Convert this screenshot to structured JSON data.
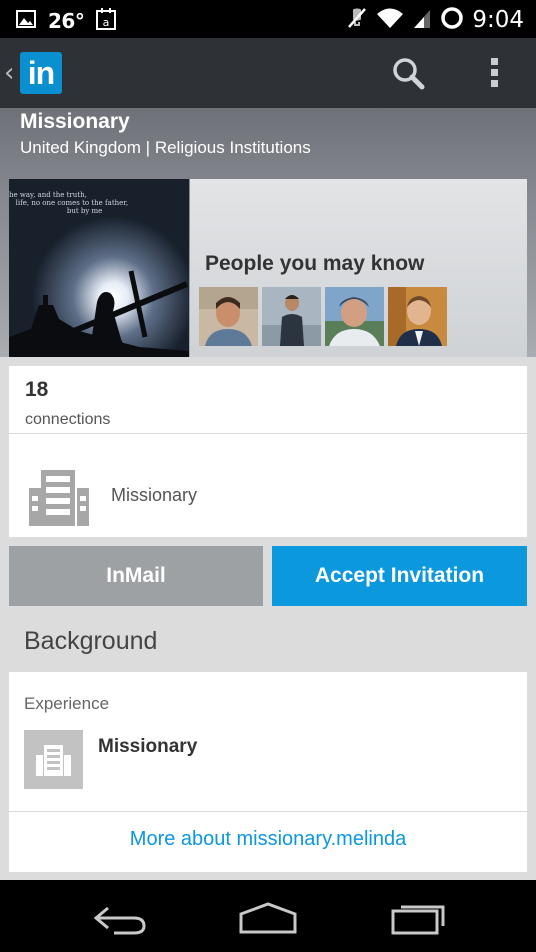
{
  "status_bar": {
    "temperature": "26°",
    "time": "9:04",
    "icons": [
      "picture-icon",
      "calendar-icon",
      "mute-icon",
      "wifi-icon",
      "signal-icon",
      "sync-circle-icon"
    ]
  },
  "action_bar": {
    "logo_text": "in",
    "icons": [
      "back-chevron-icon",
      "search-icon",
      "overflow-menu-icon"
    ]
  },
  "profile": {
    "name": "Missionary",
    "subtitle": "United Kingdom | Religious Institutions",
    "background_photo_quote": "he way, and the truth,\n   life, no one comes to the father,\n                          but by me"
  },
  "people_you_may_know": {
    "title": "People you may know"
  },
  "connections": {
    "count": "18",
    "label": "connections"
  },
  "company": {
    "name": "Missionary",
    "icon": "building-icon"
  },
  "actions": {
    "inmail_label": "InMail",
    "accept_label": "Accept Invitation"
  },
  "background": {
    "section_title": "Background",
    "experience_label": "Experience",
    "experience_title": "Missionary",
    "more_link": "More about missionary.melinda"
  },
  "nav_bar": {
    "icons": [
      "back-icon",
      "home-icon",
      "recents-icon"
    ]
  },
  "colors": {
    "accent_blue": "#0b98dd",
    "linkedin_blue": "#0a8fd0",
    "action_bar": "#2e3136",
    "inmail_gray": "#9ea1a4"
  }
}
